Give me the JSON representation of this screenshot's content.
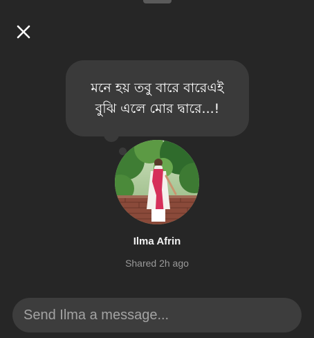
{
  "note": {
    "text": "মনে হয় তবু বারে বারেএই\nবুঝি এলে মোর দ্বারে...!"
  },
  "profile": {
    "name": "Ilma Afrin",
    "shared_time": "Shared 2h ago"
  },
  "composer": {
    "placeholder": "Send Ilma a message..."
  },
  "colors": {
    "background": "#262626",
    "bubble": "#3a3a3a",
    "input": "#3d3d3d",
    "secondary_text": "#9a9a9a"
  },
  "icons": {
    "close": "close-icon"
  }
}
